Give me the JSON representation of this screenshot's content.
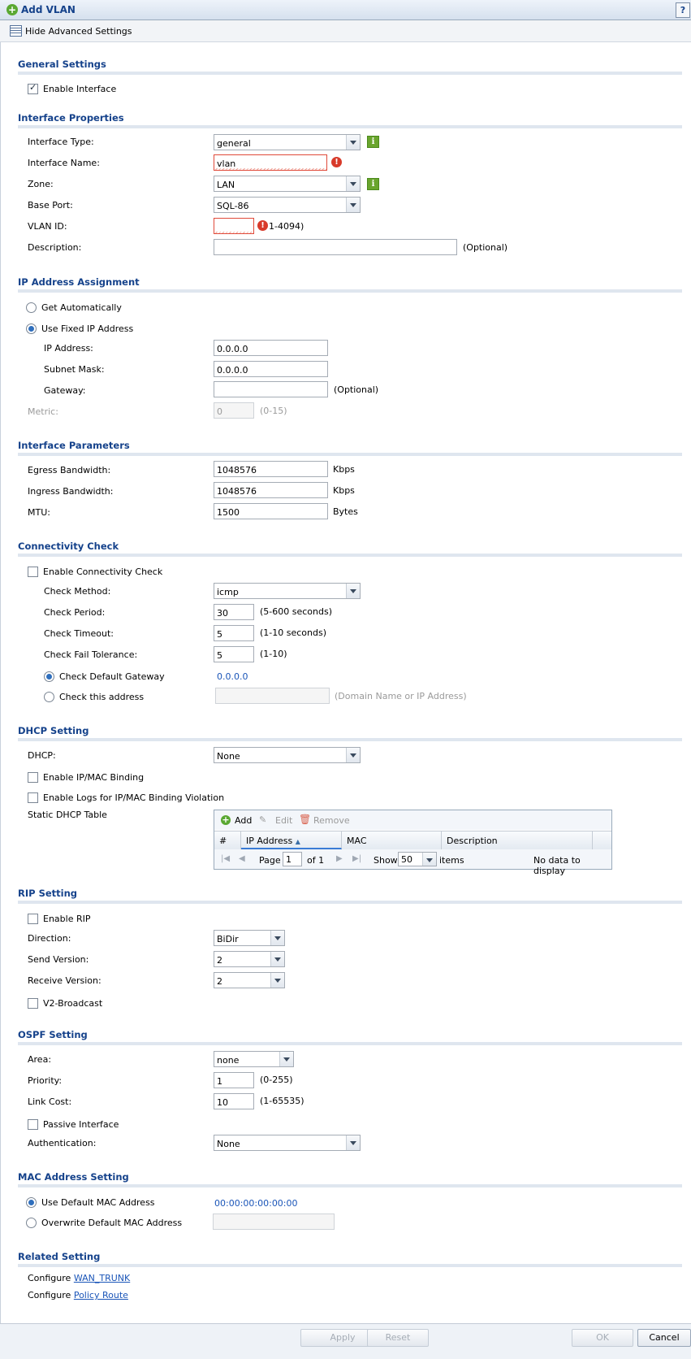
{
  "window": {
    "title": "Add VLAN",
    "help": "?"
  },
  "toolbar": {
    "advanced_label": "Hide Advanced Settings"
  },
  "general": {
    "title": "General Settings",
    "enable_interface": "Enable Interface"
  },
  "props": {
    "title": "Interface Properties",
    "type_label": "Interface Type:",
    "type_value": "general",
    "name_label": "Interface Name:",
    "name_value": "vlan",
    "zone_label": "Zone:",
    "zone_value": "LAN",
    "base_port_label": "Base Port:",
    "base_port_value": "SQL-86",
    "vlan_id_label": "VLAN ID:",
    "vlan_id_value": "",
    "vlan_id_hint": "1-4094)",
    "desc_label": "Description:",
    "desc_value": "",
    "desc_hint": "(Optional)"
  },
  "ip": {
    "title": "IP Address Assignment",
    "get_auto": "Get Automatically",
    "use_fixed": "Use Fixed IP Address",
    "addr_label": "IP Address:",
    "addr_value": "0.0.0.0",
    "mask_label": "Subnet Mask:",
    "mask_value": "0.0.0.0",
    "gw_label": "Gateway:",
    "gw_value": "",
    "gw_hint": "(Optional)",
    "metric_label": "Metric:",
    "metric_value": "0",
    "metric_hint": "(0-15)"
  },
  "params": {
    "title": "Interface Parameters",
    "egress_label": "Egress Bandwidth:",
    "egress_value": "1048576",
    "egress_unit": "Kbps",
    "ingress_label": "Ingress Bandwidth:",
    "ingress_value": "1048576",
    "ingress_unit": "Kbps",
    "mtu_label": "MTU:",
    "mtu_value": "1500",
    "mtu_unit": "Bytes"
  },
  "conn": {
    "title": "Connectivity Check",
    "enable": "Enable Connectivity Check",
    "method_label": "Check Method:",
    "method_value": "icmp",
    "period_label": "Check Period:",
    "period_value": "30",
    "period_hint": "(5-600 seconds)",
    "timeout_label": "Check Timeout:",
    "timeout_value": "5",
    "timeout_hint": "(1-10 seconds)",
    "fail_label": "Check Fail Tolerance:",
    "fail_value": "5",
    "fail_hint": "(1-10)",
    "default_gw": "Check Default Gateway",
    "default_gw_value": "0.0.0.0",
    "this_addr": "Check this address",
    "this_addr_value": "",
    "this_addr_hint": "(Domain Name or IP Address)"
  },
  "dhcp": {
    "title": "DHCP Setting",
    "dhcp_label": "DHCP:",
    "dhcp_value": "None",
    "binding": "Enable IP/MAC Binding",
    "logs": "Enable Logs for IP/MAC Binding Violation",
    "table_label": "Static DHCP Table",
    "add": "Add",
    "edit": "Edit",
    "remove": "Remove",
    "columns": [
      "#",
      "IP Address",
      "MAC",
      "Description"
    ],
    "page_label": "Page",
    "page_value": "1",
    "of_label": "of 1",
    "show_label": "Show",
    "show_value": "50",
    "items_label": "items",
    "empty": "No data to display"
  },
  "rip": {
    "title": "RIP Setting",
    "enable": "Enable RIP",
    "dir_label": "Direction:",
    "dir_value": "BiDir",
    "send_label": "Send Version:",
    "send_value": "2",
    "recv_label": "Receive Version:",
    "recv_value": "2",
    "v2b": "V2-Broadcast"
  },
  "ospf": {
    "title": "OSPF Setting",
    "area_label": "Area:",
    "area_value": "none",
    "prio_label": "Priority:",
    "prio_value": "1",
    "prio_hint": "(0-255)",
    "cost_label": "Link Cost:",
    "cost_value": "10",
    "cost_hint": "(1-65535)",
    "passive": "Passive Interface",
    "auth_label": "Authentication:",
    "auth_value": "None"
  },
  "mac": {
    "title": "MAC Address Setting",
    "use_default": "Use Default MAC Address",
    "default_value": "00:00:00:00:00:00",
    "overwrite": "Overwrite Default MAC Address",
    "overwrite_value": ""
  },
  "related": {
    "title": "Related Setting",
    "configure": "Configure",
    "wan_trunk": "WAN_TRUNK",
    "policy_route": "Policy Route"
  },
  "footer": {
    "apply": "Apply",
    "reset": "Reset",
    "ok": "OK",
    "cancel": "Cancel"
  }
}
